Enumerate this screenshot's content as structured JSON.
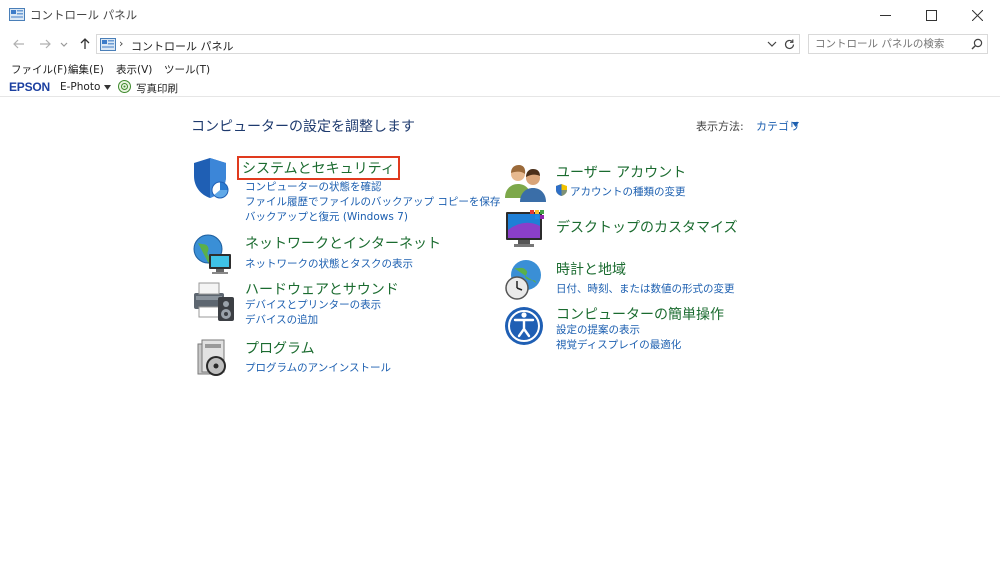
{
  "window": {
    "title": "コントロール パネル",
    "buttons": {
      "minimize": "minimize-icon",
      "maximize": "maximize-icon",
      "close": "close-icon"
    }
  },
  "nav": {
    "breadcrumb": "コントロール パネル",
    "separator": "›",
    "search_placeholder": "コントロール パネルの検索"
  },
  "menu": [
    "ファイル(F)",
    "編集(E)",
    "表示(V)",
    "ツール(T)"
  ],
  "epson": {
    "logo": "EPSON",
    "app": "E-Photo",
    "photo_print": "写真印刷"
  },
  "main": {
    "title": "コンピューターの設定を調整します",
    "view_label": "表示方法:",
    "view_value": "カテゴリ"
  },
  "categories_left": [
    {
      "title": "システムとセキュリティ",
      "links": [
        "コンピューターの状態を確認",
        "ファイル履歴でファイルのバックアップ コピーを保存",
        "バックアップと復元 (Windows 7)"
      ]
    },
    {
      "title": "ネットワークとインターネット",
      "links": [
        "ネットワークの状態とタスクの表示"
      ]
    },
    {
      "title": "ハードウェアとサウンド",
      "links": [
        "デバイスとプリンターの表示",
        "デバイスの追加"
      ]
    },
    {
      "title": "プログラム",
      "links": [
        "プログラムのアンインストール"
      ]
    }
  ],
  "categories_right": [
    {
      "title": "ユーザー アカウント",
      "links": [
        "アカウントの種類の変更"
      ]
    },
    {
      "title": "デスクトップのカスタマイズ",
      "links": []
    },
    {
      "title": "時計と地域",
      "links": [
        "日付、時刻、または数値の形式の変更"
      ]
    },
    {
      "title": "コンピューターの簡単操作",
      "links": [
        "設定の提案の表示",
        "視覚ディスプレイの最適化"
      ]
    }
  ],
  "colors": {
    "link": "#1c5fb0",
    "category_title": "#1a6b2f",
    "highlight": "#e03a1e",
    "page_title": "#1e3a6e"
  }
}
